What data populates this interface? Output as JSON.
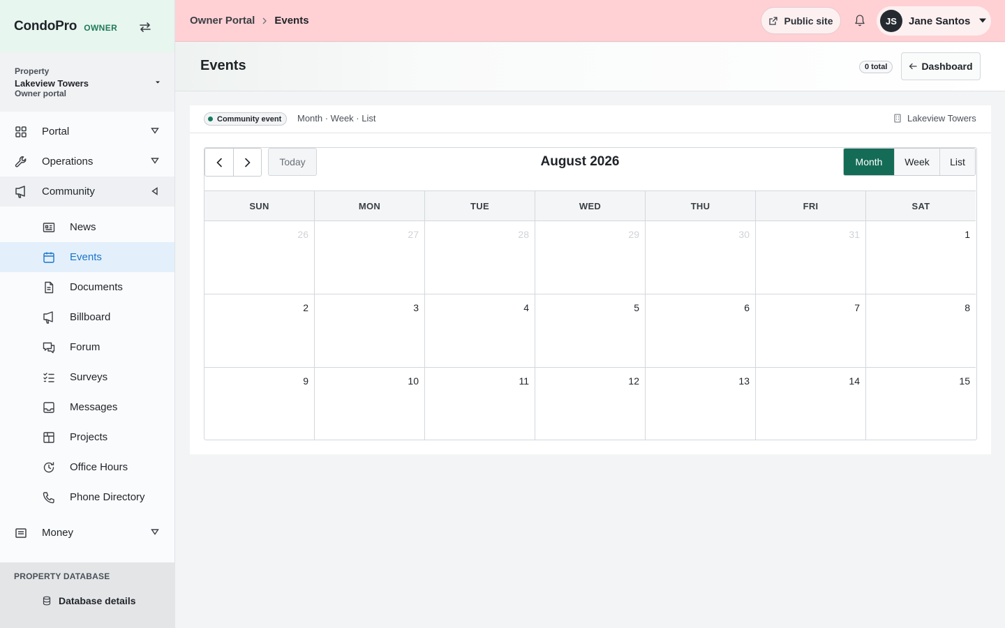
{
  "brand": {
    "name": "CondoPro",
    "role": "OWNER"
  },
  "property": {
    "label": "Property",
    "name": "Lakeview Towers",
    "sub": "Owner portal"
  },
  "nav": {
    "portal": "Portal",
    "operations": "Operations",
    "community": "Community",
    "money": "Money",
    "community_items": [
      {
        "label": "News",
        "icon": "newspaper-icon"
      },
      {
        "label": "Events",
        "icon": "calendar-icon"
      },
      {
        "label": "Documents",
        "icon": "document-icon"
      },
      {
        "label": "Billboard",
        "icon": "megaphone-icon"
      },
      {
        "label": "Forum",
        "icon": "chat-icon"
      },
      {
        "label": "Surveys",
        "icon": "checklist-icon"
      },
      {
        "label": "Messages",
        "icon": "inbox-icon"
      },
      {
        "label": "Projects",
        "icon": "grid-icon"
      },
      {
        "label": "Office Hours",
        "icon": "clock-icon"
      },
      {
        "label": "Phone Directory",
        "icon": "phone-icon"
      }
    ]
  },
  "db": {
    "title": "PROPERTY DATABASE",
    "item": "Database details"
  },
  "topbar": {
    "crumb_root": "Owner Portal",
    "crumb_current": "Events",
    "public_site": "Public site",
    "user_initials": "JS",
    "user_name": "Jane Santos"
  },
  "page": {
    "title": "Events",
    "total": "0 total",
    "dashboard": "Dashboard"
  },
  "card": {
    "legend": "Community event",
    "view_hint": "Month · Week · List",
    "property_tag": "Lakeview Towers"
  },
  "calendar": {
    "title": "August 2026",
    "today": "Today",
    "views": [
      "Month",
      "Week",
      "List"
    ],
    "active_view": "Month",
    "weekdays": [
      "SUN",
      "MON",
      "TUE",
      "WED",
      "THU",
      "FRI",
      "SAT"
    ],
    "weeks": [
      [
        "26",
        "27",
        "28",
        "29",
        "30",
        "31",
        "1"
      ],
      [
        "2",
        "3",
        "4",
        "5",
        "6",
        "7",
        "8"
      ],
      [
        "9",
        "10",
        "11",
        "12",
        "13",
        "14",
        "15"
      ]
    ],
    "other_month_days_in_first_week": 6
  },
  "colors": {
    "accent": "#146c57",
    "topbar": "#ffd1d4",
    "active_nav": "#1a73c9"
  }
}
